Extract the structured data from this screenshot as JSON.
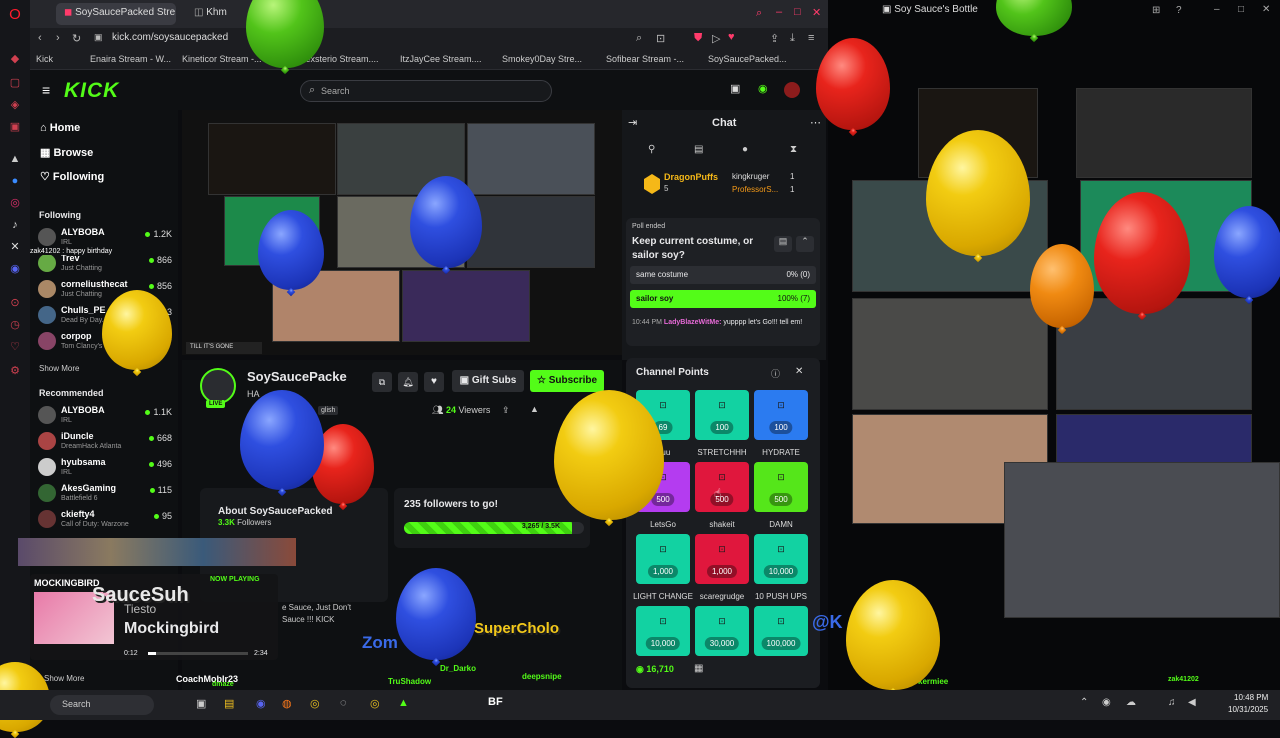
{
  "browser": {
    "tabs": [
      {
        "label": "SoySaucePacked Stre"
      },
      {
        "label": "Khm"
      }
    ],
    "url": "kick.com/soysaucepacked",
    "bookmarks": [
      "Kick",
      "Enaira Stream - W...",
      "Kineticor Stream -...",
      "Mexsterio Stream....",
      "ItzJayCee Stream....",
      "Smokey0Day Stre...",
      "Sofibear Stream -...",
      "SoySaucePacked..."
    ]
  },
  "right_window": {
    "title": "Soy Sauce's Bottle"
  },
  "kick": {
    "logo": "KICK",
    "search_placeholder": "Search",
    "nav": {
      "home": "Home",
      "browse": "Browse",
      "following": "Following"
    },
    "following_header": "Following",
    "following": [
      {
        "name": "ALYBOBA",
        "category": "IRL",
        "viewers": "1.2K"
      },
      {
        "name": "Trev",
        "category": "Just Chatting",
        "viewers": "866"
      },
      {
        "name": "corneliusthecat",
        "category": "Just Chatting",
        "viewers": "856"
      },
      {
        "name": "Chulls_PE",
        "category": "Dead By Day...",
        "viewers": "3"
      },
      {
        "name": "corpop",
        "category": "Tom Clancy's",
        "viewers": "3"
      }
    ],
    "show_more": "Show More",
    "recommended_header": "Recommended",
    "recommended": [
      {
        "name": "ALYBOBA",
        "category": "IRL",
        "viewers": "1.1K"
      },
      {
        "name": "iDuncle",
        "category": "DreamHack Atlanta",
        "viewers": "668"
      },
      {
        "name": "hyubsama",
        "category": "IRL",
        "viewers": "496"
      },
      {
        "name": "AkesGaming",
        "category": "Battlefield 6",
        "viewers": "115"
      },
      {
        "name": "ckiefty4",
        "category": "Call of Duty: Warzone",
        "viewers": "95"
      }
    ],
    "show_more_2": "Show More",
    "chat_tag": "zak41202 : happy birthday",
    "video_caption": "TILL IT'S GONE",
    "streamer": {
      "name": "SoySaucePacke",
      "live_badge": "LIVE",
      "title_partial": "HA",
      "lang": "glish",
      "viewers": "24",
      "viewers_label": "Viewers",
      "gift_subs": "Gift Subs",
      "subscribe": "Subscribe"
    },
    "about": {
      "title": "About SoySaucePacked",
      "followers": "3.3K",
      "followers_label": "Followers",
      "bio_line1": "e Sauce, Just Don't",
      "bio_line2": "Sauce !!! KICK"
    },
    "goal": {
      "text": "235 followers to go!",
      "progress": "3,265 / 3.5K",
      "progress_fraction": 0.933
    },
    "chat": {
      "title": "Chat",
      "gifters": [
        {
          "name": "DragonPuffs",
          "count": "5"
        },
        {
          "name": "kingkruger",
          "count": "1"
        },
        {
          "name": "ProfessorS...",
          "count": "1"
        }
      ],
      "poll": {
        "status": "Poll ended",
        "question": "Keep current costume, or sailor soy?",
        "options": [
          {
            "label": "same costume",
            "result": "0% (0)",
            "fraction": 0
          },
          {
            "label": "sailor soy",
            "result": "100% (7)",
            "fraction": 1
          }
        ]
      },
      "message": {
        "time": "10:44 PM",
        "user": "LadyBlazeWitMe:",
        "text": "yupppp let's Go!!! tell em!"
      }
    },
    "channel_points": {
      "title": "Channel Points",
      "rewards": [
        {
          "cost": "69",
          "label": "wuu",
          "color": "#12d2a2"
        },
        {
          "cost": "100",
          "label": "STRETCHHH",
          "color": "#12d2a2"
        },
        {
          "cost": "100",
          "label": "HYDRATE",
          "color": "#2b7bf0"
        },
        {
          "cost": "500",
          "label": "LetsGo",
          "color": "#b43cf0"
        },
        {
          "cost": "500",
          "label": "shakeit",
          "color": "#e0173d"
        },
        {
          "cost": "500",
          "label": "DAMN",
          "color": "#55e61a"
        },
        {
          "cost": "1,000",
          "label": "LIGHT CHANGE",
          "color": "#12d2a2"
        },
        {
          "cost": "1,000",
          "label": "scaregrudge",
          "color": "#e0173d"
        },
        {
          "cost": "10,000",
          "label": "10 PUSH UPS",
          "color": "#12d2a2"
        },
        {
          "cost": "10,000",
          "label": "",
          "color": "#12d2a2"
        },
        {
          "cost": "30,000",
          "label": "",
          "color": "#12d2a2"
        },
        {
          "cost": "100,000",
          "label": "",
          "color": "#12d2a2"
        }
      ],
      "balance": "16,710"
    }
  },
  "now_playing": {
    "header": "MOCKINGBIRD",
    "status": "NOW PLAYING",
    "artist": "Tiesto",
    "track": "Mockingbird",
    "elapsed": "0:12",
    "total": "2:34",
    "progress_fraction": 0.08
  },
  "overlay": {
    "name1": "SauceSuh",
    "name2": "SuperCholo",
    "name3": "Zom",
    "name4": "@K",
    "small": [
      "CoachMobIr23",
      "TruShadow",
      "Dr_Darko",
      "deepsnipe",
      "zak41202",
      "kermiee",
      "dmaze"
    ]
  },
  "taskbar": {
    "search": "Search",
    "time": "10:48 PM",
    "date": "10/31/2025"
  }
}
